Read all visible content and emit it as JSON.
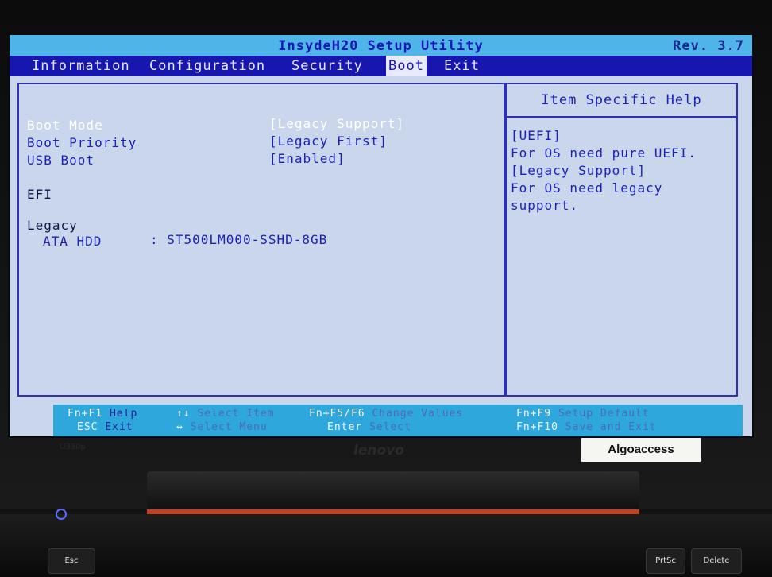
{
  "bios": {
    "title": "InsydeH20 Setup Utility",
    "revision": "Rev. 3.7",
    "menu": [
      {
        "label": "Information"
      },
      {
        "label": "Configuration"
      },
      {
        "label": "Security"
      },
      {
        "label": "Boot"
      },
      {
        "label": "Exit"
      }
    ],
    "active_menu": "Boot",
    "settings": [
      {
        "label": "Boot Mode",
        "value": "[Legacy Support]"
      },
      {
        "label": "Boot Priority",
        "value": "[Legacy First]"
      },
      {
        "label": "USB Boot",
        "value": "[Enabled]"
      }
    ],
    "sections": {
      "efi": "EFI",
      "legacy": "Legacy"
    },
    "devices": [
      {
        "label": "ATA HDD",
        "value": ": ST500LM000-SSHD-8GB"
      }
    ],
    "help": {
      "title": "Item Specific Help",
      "lines": [
        "[UEFI]",
        "For OS need pure UEFI.",
        "[Legacy Support]",
        "For OS need legacy",
        "support."
      ]
    },
    "keys": [
      {
        "key": "Fn+F1",
        "desc": "Help"
      },
      {
        "key": "ESC",
        "desc": "Exit"
      },
      {
        "key": "↑↓",
        "desc": "Select Item"
      },
      {
        "key": "↔",
        "desc": "Select Menu"
      },
      {
        "key": "Fn+F5/F6",
        "desc": "Change Values"
      },
      {
        "key": "Enter",
        "desc": "Select"
      },
      {
        "key": "Fn+F9",
        "desc": "Setup Default"
      },
      {
        "key": "Fn+F10",
        "desc": "Save and Exit"
      }
    ]
  },
  "laptop": {
    "brand": "lenovo",
    "model": "U330p",
    "sticker": "Algoaccess",
    "keyboard_keys": [
      "Esc",
      "PrtSc",
      "Delete"
    ]
  },
  "colors": {
    "bios_bg": "#c9d6ec",
    "menu_bar": "#1717b0",
    "title_bar": "#4fb4e7",
    "status_bar": "#2ea8dc",
    "text_blue": "#1d1fb5",
    "selected_text": "#ffffff"
  }
}
